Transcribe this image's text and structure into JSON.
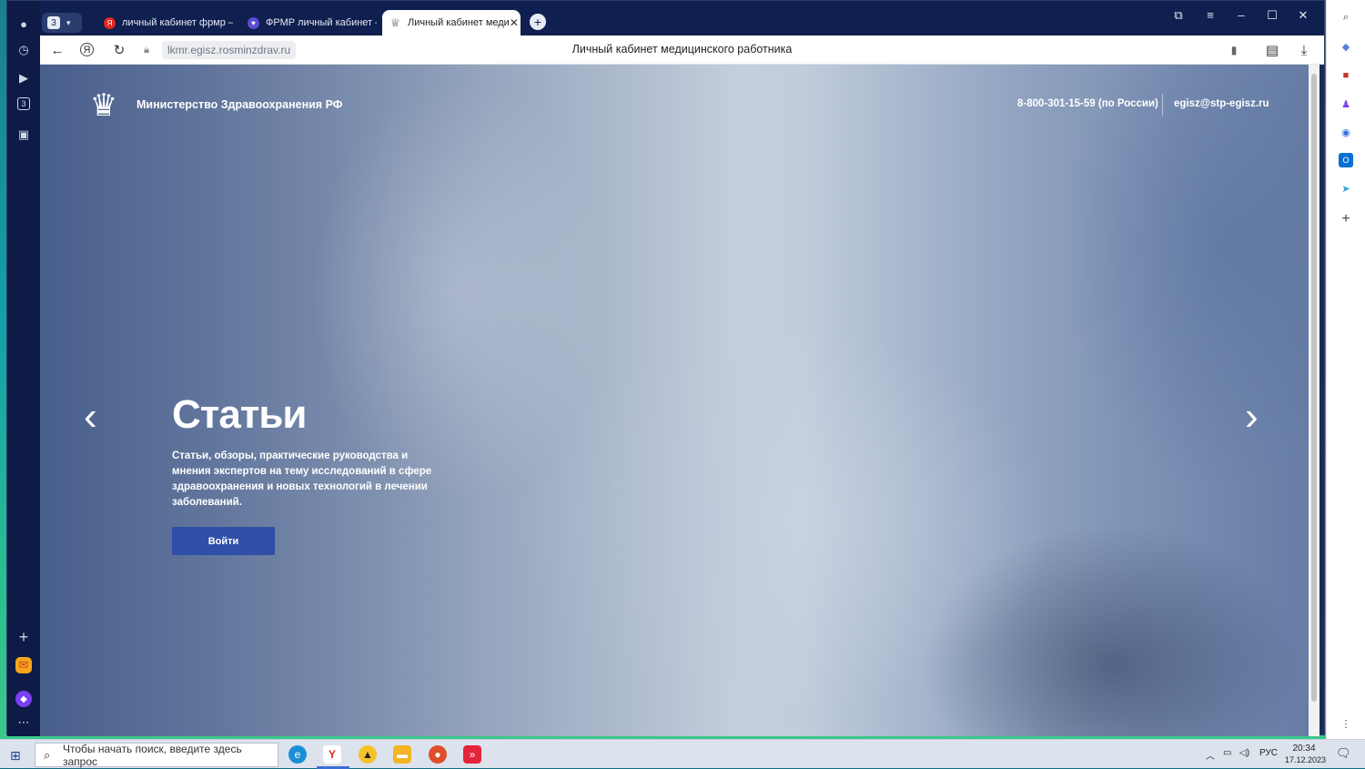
{
  "browser": {
    "tab_counter": "3",
    "tabs": [
      {
        "label": "личный кабинет фрмр —",
        "favicon_color": "#e52620",
        "favicon": "Я"
      },
      {
        "label": "ФРМР личный кабинет —",
        "favicon_color": "#5b4bd6",
        "favicon": "♥"
      },
      {
        "label": "Личный кабинет меди",
        "favicon_color": "#444444",
        "favicon": "♕",
        "active": true
      }
    ],
    "url": "lkmr.egisz.rosminzdrav.ru",
    "page_title": "Личный кабинет медицинского работника"
  },
  "site": {
    "brand": "Министерство Здравоохранения РФ",
    "phone": "8-800-301-15-59 (по России)",
    "email": "egisz@stp-egisz.ru",
    "hero_title": "Статьи",
    "hero_lead": "Статьи, обзоры, практические руководства и мнения экспертов на тему исследований в сфере здравоохранения и новых технологий в лечении заболеваний.",
    "login_label": "Войти",
    "prev_arrow": "‹",
    "next_arrow": "›"
  },
  "taskbar": {
    "search_placeholder": "Чтобы начать поиск, введите здесь запрос",
    "lang": "РУС",
    "time": "20:34",
    "date": "17.12.2023"
  },
  "colors": {
    "accent": "#2f4fa8",
    "browser_frame": "#0f1f4f"
  }
}
